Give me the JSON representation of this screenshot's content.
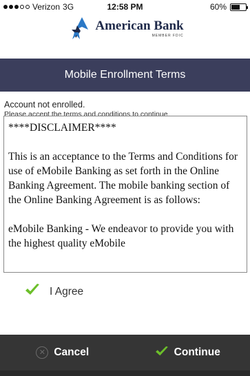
{
  "status_bar": {
    "carrier": "Verizon",
    "network": "3G",
    "time": "12:58 PM",
    "battery": "60%",
    "battery_level": 0.6
  },
  "brand": {
    "name": "American Bank",
    "tagline": "MEMBER FDIC",
    "logo_icon": "eagle-star-logo"
  },
  "header": {
    "title": "Mobile Enrollment Terms"
  },
  "message": {
    "status": "Account not enrolled.",
    "instruction": "Please accept the terms and conditions to continue."
  },
  "terms": {
    "paragraphs": [
      "****DISCLAIMER****",
      "This is an acceptance to the Terms and Conditions for use of eMobile Banking as set forth in the Online Banking Agreement. The mobile banking section of the Online Banking Agreement is as follows:",
      "eMobile Banking - We endeavor to provide you with the highest quality eMobile"
    ]
  },
  "agree": {
    "label": "I Agree",
    "checked": true,
    "icon": "checkmark-icon"
  },
  "actions": {
    "cancel_label": "Cancel",
    "continue_label": "Continue",
    "cancel_icon": "close-circle-icon",
    "continue_icon": "checkmark-icon"
  },
  "colors": {
    "header_bg": "#3b3e5c",
    "bottom_bar_bg": "#353535",
    "check_green": "#6cbf2a",
    "brand_navy": "#1f2a4a",
    "brand_blue": "#2a78c6"
  }
}
